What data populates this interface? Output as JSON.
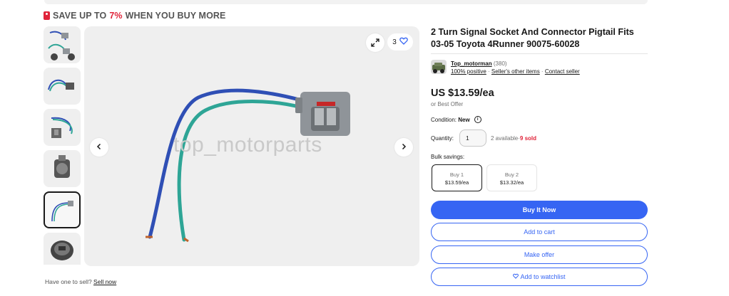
{
  "promo": {
    "prefix": "SAVE UP TO ",
    "percent": "7%",
    "suffix": " WHEN YOU BUY MORE"
  },
  "gallery": {
    "watermark": "top_motorparts",
    "like_count": "3",
    "thumbnails": [
      "thumb-1",
      "thumb-2",
      "thumb-3",
      "thumb-4",
      "thumb-5",
      "thumb-6"
    ],
    "active_index": 4
  },
  "sell": {
    "text": "Have one to sell? ",
    "link": "Sell now"
  },
  "product": {
    "title": "2 Turn Signal Socket And Connector Pigtail Fits 03-05 Toyota 4Runner 90075-60028"
  },
  "seller": {
    "name": "Top_motorman",
    "count": "(380)",
    "positive": "100% positive",
    "other_items": "Seller's other items",
    "contact": "Contact seller",
    "sep": " · "
  },
  "price": {
    "value": "US $13.59/ea",
    "offer": "or Best Offer"
  },
  "condition": {
    "label": "Condition: ",
    "value": "New"
  },
  "quantity": {
    "label": "Quantity:",
    "value": "1",
    "available": "2 available",
    "sep": " · ",
    "sold": "9 sold"
  },
  "bulk": {
    "label": "Bulk savings:",
    "options": [
      {
        "title": "Buy 1",
        "price": "$13.59/ea"
      },
      {
        "title": "Buy 2",
        "price": "$13.32/ea"
      }
    ]
  },
  "actions": {
    "buy": "Buy It Now",
    "cart": "Add to cart",
    "offer": "Make offer",
    "watch": "Add to watchlist"
  },
  "colors": {
    "accent": "#3665f3",
    "sale": "#e0243a",
    "wire_blue": "#2f4fb5",
    "wire_green": "#2ea596",
    "connector": "#8f9499"
  },
  "icons": {
    "expand": "expand-icon",
    "heart": "heart-icon",
    "prev": "chevron-left-icon",
    "next": "chevron-right-icon",
    "info": "info-icon",
    "tag": "sale-tag-icon"
  }
}
